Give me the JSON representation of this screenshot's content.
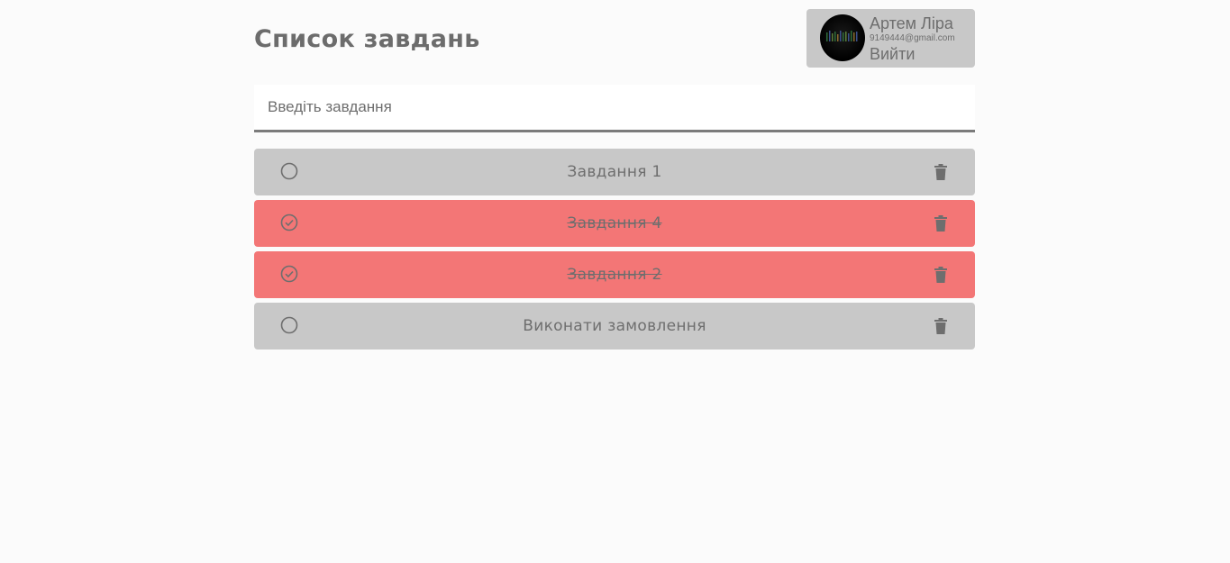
{
  "header": {
    "title": "Список завдань"
  },
  "user": {
    "name": "Артем Ліра",
    "email": "9149444@gmail.com",
    "logout_label": "Вийти"
  },
  "task_input": {
    "placeholder": "Введіть завдання",
    "value": ""
  },
  "tasks": [
    {
      "text": "Завдання 1",
      "completed": false
    },
    {
      "text": "Завдання 4",
      "completed": true
    },
    {
      "text": "Завдання 2",
      "completed": true
    },
    {
      "text": "Виконати замовлення",
      "completed": false
    }
  ],
  "colors": {
    "background": "#fbfbfb",
    "task_default": "#c8c8c8",
    "task_completed": "#f37676",
    "text": "#6e6e6e",
    "input_border": "#7b7b7b"
  }
}
